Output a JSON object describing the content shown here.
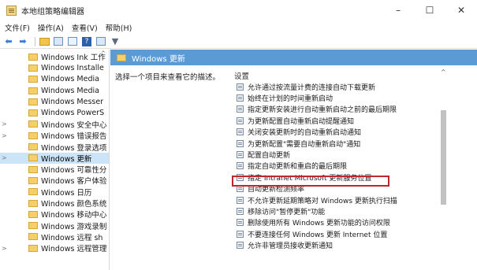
{
  "window": {
    "title": "本地组策略编辑器",
    "minimize_glyph": "–",
    "maximize_glyph": "☐",
    "close_glyph": "✕"
  },
  "menu": {
    "items": [
      {
        "label": "文件(F)"
      },
      {
        "label": "操作(A)"
      },
      {
        "label": "查看(V)"
      },
      {
        "label": "帮助(H)"
      }
    ]
  },
  "toolbar": {
    "icons": [
      "back-arrow-icon",
      "forward-arrow-icon",
      "up-folder-icon",
      "show-hide-tree-icon",
      "export-list-icon",
      "help-icon",
      "properties-icon",
      "filter-icon"
    ],
    "help_glyph": "?",
    "filter_glyph": "▼",
    "back_glyph": "⬅",
    "forward_glyph": "➡"
  },
  "tree": {
    "items": [
      {
        "label": "Windows Ink 工作",
        "expander": ""
      },
      {
        "label": "Windows Installe",
        "expander": ""
      },
      {
        "label": "Windows Media",
        "expander": ""
      },
      {
        "label": "Windows Media",
        "expander": ""
      },
      {
        "label": "Windows Messer",
        "expander": ""
      },
      {
        "label": "Windows PowerS",
        "expander": ""
      },
      {
        "label": "Windows 安全中心",
        "expander": ">"
      },
      {
        "label": "Windows 错误报告",
        "expander": ">"
      },
      {
        "label": "Windows 登录选项",
        "expander": ""
      },
      {
        "label": "Windows 更新",
        "expander": ">",
        "selected": true
      },
      {
        "label": "Windows 可靠性分",
        "expander": ""
      },
      {
        "label": "Windows 客户体验",
        "expander": ""
      },
      {
        "label": "Windows 日历",
        "expander": ""
      },
      {
        "label": "Windows 颜色系统",
        "expander": ""
      },
      {
        "label": "Windows 移动中心",
        "expander": ""
      },
      {
        "label": "Windows 游戏录制",
        "expander": ""
      },
      {
        "label": "Windows 远程 sh",
        "expander": ""
      },
      {
        "label": "Windows 远程管理",
        "expander": ">"
      }
    ],
    "scroll_up_glyph": "^"
  },
  "pane": {
    "header": "Windows 更新",
    "description": "选择一个项目来查看它的描述。",
    "column_settings": "设置"
  },
  "settings": [
    "允许通过按流量计费的连接自动下载更新",
    "始终在计划的时间重新启动",
    "指定更新安装进行自动重新启动之前的最后期限",
    "为更新配置自动重新启动提醒通知",
    "关闭安装更新时的自动重新启动通知",
    "为更新配置\"需要自动重新启动\"通知",
    "配置自动更新",
    "指定自动更新和重启的最后期限",
    "指定 Intranet Microsoft 更新服务位置",
    "自动更新检测频率",
    "不允许更新延期策略对 Windows 更新执行扫描",
    "移除访问\"暂停更新\"功能",
    "删除使用所有 Windows 更新功能的访问权限",
    "不要连接任何 Windows 更新 Internet 位置",
    "允许非管理员接收更新通知"
  ],
  "scrollbar": {
    "up_glyph": "^"
  },
  "colors": {
    "header_blue": "#5b9bd5",
    "selection": "#cce4f7",
    "highlight_red": "#c0272d"
  }
}
